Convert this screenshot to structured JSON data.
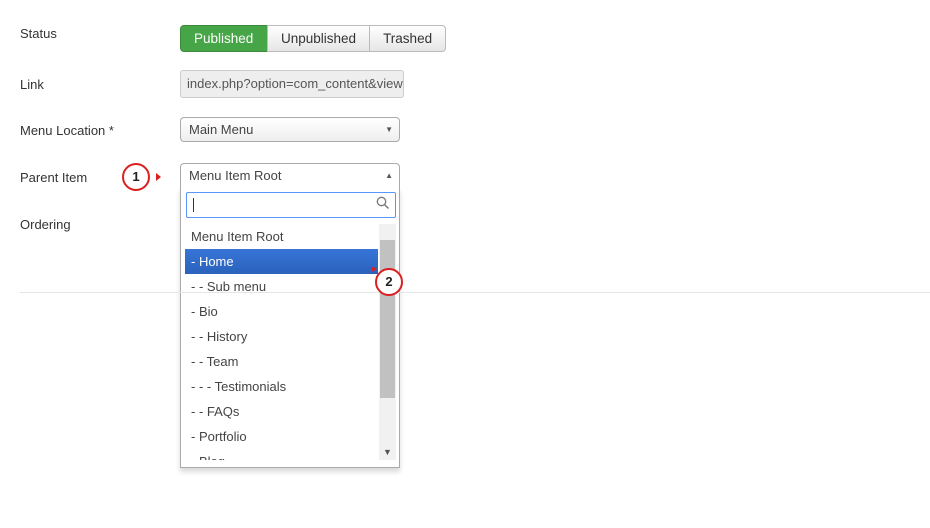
{
  "form": {
    "status_label": "Status",
    "link_label": "Link",
    "menu_location_label": "Menu Location *",
    "parent_item_label": "Parent Item",
    "ordering_label": "Ordering"
  },
  "status_buttons": {
    "published": "Published",
    "unpublished": "Unpublished",
    "trashed": "Trashed",
    "active": "Published",
    "active_color": "#46a546"
  },
  "link": {
    "value": "index.php?option=com_content&view"
  },
  "menu_location": {
    "selected": "Main Menu"
  },
  "parent_item": {
    "selected": "Menu Item Root",
    "search_value": "",
    "options": [
      "Menu Item Root",
      "- Home",
      "- - Sub menu",
      "- Bio",
      "- - History",
      "- - Team",
      "- - - Testimonials",
      "- - FAQs",
      "- Portfolio",
      "- Blog"
    ],
    "highlighted_option": "- Home",
    "highlight_color": "#3875d7"
  },
  "callouts": {
    "one": "1",
    "two": "2",
    "color": "#d9201f"
  },
  "icons": [
    "chevron-down-icon",
    "chevron-up-icon",
    "search-icon",
    "scroll-down-arrow-icon"
  ]
}
